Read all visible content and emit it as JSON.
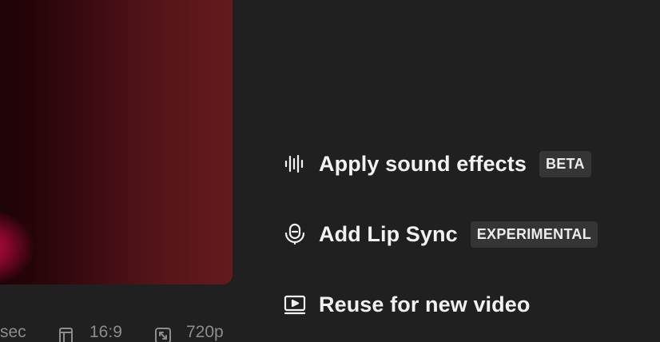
{
  "preview": {
    "gradient_colors": [
      "#1b0308",
      "#3e0c12",
      "#641a1d"
    ],
    "accent_color": "#d20a46"
  },
  "meta": {
    "duration": "sec",
    "ratio": "16:9",
    "resolution": "720p",
    "ratio_icon": "aspect-ratio-icon",
    "resolution_icon": "expand-icon"
  },
  "actions": [
    {
      "label": "Apply sound effects",
      "badge": "BETA",
      "icon": "sound-wave-icon"
    },
    {
      "label": "Add Lip Sync",
      "badge": "EXPERIMENTAL",
      "icon": "lip-sync-icon"
    },
    {
      "label": "Reuse for new video",
      "badge": "",
      "icon": "play-screen-icon"
    }
  ],
  "colors": {
    "background": "#202020",
    "text": "#f2f2f2",
    "muted": "#8d8d8d",
    "badge_bg": "#353535"
  }
}
